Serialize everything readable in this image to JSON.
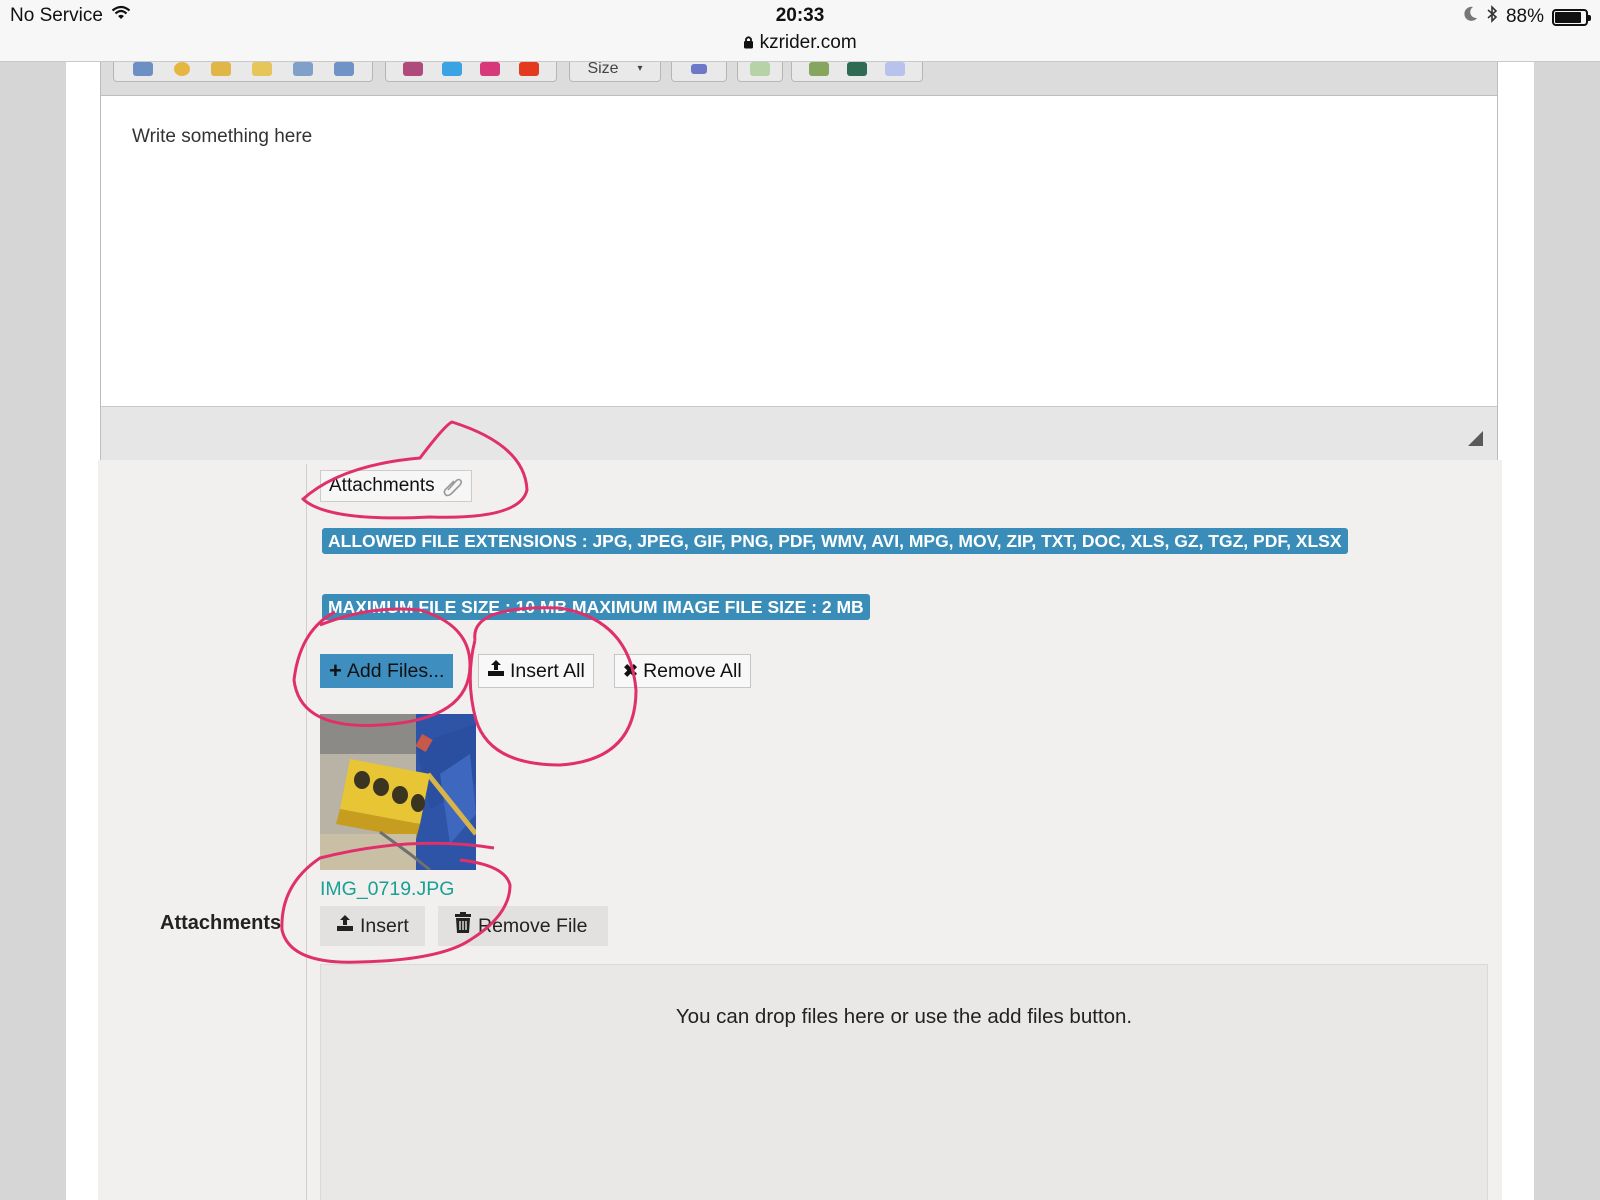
{
  "status_bar": {
    "carrier": "No Service",
    "time": "20:33",
    "url": "kzrider.com",
    "battery": "88%",
    "battery_level": 0.88
  },
  "toolbar": {
    "size_label": "Size"
  },
  "editor": {
    "placeholder": "Write something here"
  },
  "attachments": {
    "side_label": "Attachments",
    "legend": "Attachments",
    "allowed_extensions": "ALLOWED FILE EXTENSIONS : JPG, JPEG, GIF, PNG, PDF, WMV, AVI, MPG, MOV, ZIP, TXT, DOC, XLS, GZ, TGZ, PDF, XLSX",
    "max_size": "MAXIMUM FILE SIZE : 10 MB MAXIMUM IMAGE FILE SIZE : 2 MB",
    "add_files": "Add Files...",
    "insert_all": "Insert All",
    "remove_all": "Remove All",
    "file": {
      "name": "IMG_0719.JPG",
      "insert": "Insert",
      "remove": "Remove File"
    },
    "drop_text": "You can drop files here or use the add files button."
  },
  "colors": {
    "badge": "#3a8cb9",
    "file_link": "#1aa094",
    "annotation": "#e0306a"
  }
}
